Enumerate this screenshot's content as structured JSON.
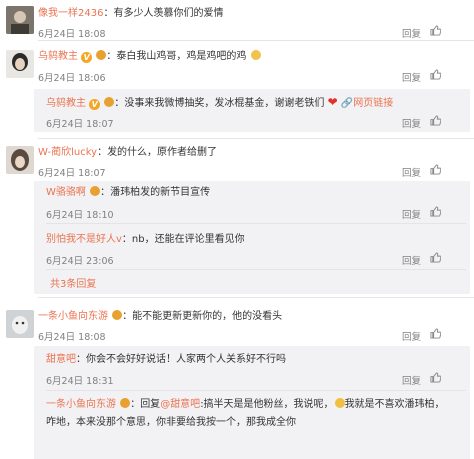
{
  "comments": [
    {
      "user": "像我一样2436",
      "sep": "：",
      "text": "有多少人羡慕你们的爱情",
      "time": "6月24日 18:08",
      "reply": "回复",
      "like": "赞"
    },
    {
      "user": "乌鸫教主",
      "sep": "：",
      "text": "泰白我山鸡哥，鸡是鸡吧的鸡",
      "time": "6月24日 18:06",
      "reply": "回复",
      "like": "赞",
      "subs": [
        {
          "user": "乌鸫教主",
          "sep": "：",
          "text": "没事来我微博抽奖，发冰棍基金，谢谢老铁们",
          "link": "网页链接",
          "time": "6月24日 18:07",
          "reply": "回复",
          "like": "赞"
        }
      ]
    },
    {
      "user": "W-蔺欣lucky",
      "sep": "：",
      "text": "发的什么，原作者给删了",
      "time": "6月24日 18:07",
      "reply": "回复",
      "like": "赞",
      "subs": [
        {
          "user": "W骆骆啊",
          "sep": "：",
          "text": "潘玮柏发的新节目宣传",
          "time": "6月24日 18:10",
          "reply": "回复",
          "like": "赞"
        },
        {
          "user": "别怕我不是好人v",
          "sep": "：",
          "text": "nb，还能在评论里看见你",
          "time": "6月24日 23:06",
          "reply": "回复",
          "like": "赞"
        }
      ],
      "more": "共3条回复"
    },
    {
      "user": "一条小鱼向东游",
      "sep": "：",
      "text": "能不能更新更新你的，他的没看头",
      "time": "6月24日 18:08",
      "reply": "回复",
      "like": "赞",
      "subs": [
        {
          "user": "甜意吧",
          "sep": "：",
          "text": "你会不会好好说话！人家两个人关系好不行吗",
          "time": "6月24日 18:31",
          "reply": "回复",
          "like": "赞"
        },
        {
          "user": "一条小鱼向东游",
          "sep": "：",
          "text": "回复",
          "mention": "@甜意吧",
          "text2": ":搞半天是是他粉丝，我说呢，",
          "text3": "我就是不喜欢潘玮柏，",
          "line2": "咋地，本来没那个意思，你非要给我按一个，那我成全你",
          "reply": "回复",
          "like": "赞"
        }
      ]
    }
  ]
}
